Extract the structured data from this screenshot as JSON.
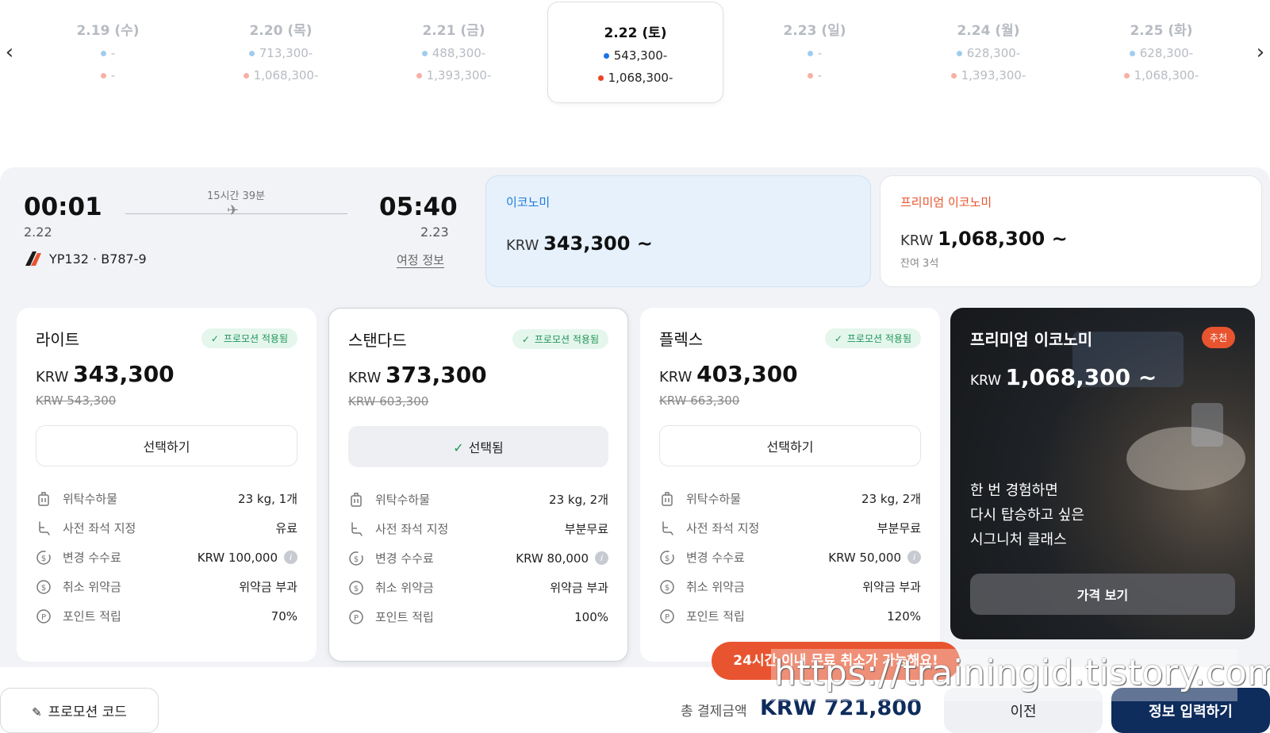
{
  "dates": [
    {
      "label": "2.19 (수)",
      "economy": "-",
      "premium": "-"
    },
    {
      "label": "2.20 (목)",
      "economy": "713,300-",
      "premium": "1,068,300-"
    },
    {
      "label": "2.21 (금)",
      "economy": "488,300-",
      "premium": "1,393,300-"
    },
    {
      "label": "2.22 (토)",
      "economy": "543,300-",
      "premium": "1,068,300-",
      "selected": true
    },
    {
      "label": "2.23 (일)",
      "economy": "-",
      "premium": "-"
    },
    {
      "label": "2.24 (월)",
      "economy": "628,300-",
      "premium": "1,393,300-"
    },
    {
      "label": "2.25 (화)",
      "economy": "628,300-",
      "premium": "1,068,300-"
    }
  ],
  "flight": {
    "dep_time": "00:01",
    "dep_date": "2.22",
    "arr_time": "05:40",
    "arr_date": "2.23",
    "duration": "15시간 39분",
    "flight_no": "YP132 · B787-9",
    "itinerary_link": "여정 정보"
  },
  "cabins": {
    "economy": {
      "name": "이코노미",
      "currency": "KRW",
      "price": "343,300 ~"
    },
    "premium": {
      "name": "프리미엄 이코노미",
      "currency": "KRW",
      "price": "1,068,300 ~",
      "seats_left": "잔여 3석"
    }
  },
  "fares": [
    {
      "name": "라이트",
      "badge": "프로모션 적용됨",
      "currency": "KRW",
      "price": "343,300",
      "original": "KRW 543,300",
      "button": "선택하기",
      "selected": false,
      "features": [
        {
          "label": "위탁수하물",
          "value": "23 kg, 1개"
        },
        {
          "label": "사전 좌석 지정",
          "value": "유료"
        },
        {
          "label": "변경 수수료",
          "value": "KRW 100,000"
        },
        {
          "label": "취소 위약금",
          "value": "위약금 부과"
        },
        {
          "label": "포인트 적립",
          "value": "70%"
        }
      ]
    },
    {
      "name": "스탠다드",
      "badge": "프로모션 적용됨",
      "currency": "KRW",
      "price": "373,300",
      "original": "KRW 603,300",
      "button": "선택됨",
      "selected": true,
      "features": [
        {
          "label": "위탁수하물",
          "value": "23 kg, 2개"
        },
        {
          "label": "사전 좌석 지정",
          "value": "부분무료"
        },
        {
          "label": "변경 수수료",
          "value": "KRW 80,000"
        },
        {
          "label": "취소 위약금",
          "value": "위약금 부과"
        },
        {
          "label": "포인트 적립",
          "value": "100%"
        }
      ]
    },
    {
      "name": "플렉스",
      "badge": "프로모션 적용됨",
      "currency": "KRW",
      "price": "403,300",
      "original": "KRW 663,300",
      "button": "선택하기",
      "selected": false,
      "features": [
        {
          "label": "위탁수하물",
          "value": "23 kg, 2개"
        },
        {
          "label": "사전 좌석 지정",
          "value": "부분무료"
        },
        {
          "label": "변경 수수료",
          "value": "KRW 50,000"
        },
        {
          "label": "취소 위약금",
          "value": "위약금 부과"
        },
        {
          "label": "포인트 적립",
          "value": "120%"
        }
      ]
    }
  ],
  "premium_card": {
    "name": "프리미엄 이코노미",
    "badge": "추천",
    "currency": "KRW",
    "price": "1,068,300 ~",
    "line1": "한 번 경험하면",
    "line2": "다시 탑승하고 싶은",
    "line3": "시그니처 클래스",
    "button": "가격 보기"
  },
  "bottom": {
    "promo_code": "프로모션 코드",
    "cancel_toast": "24시간 이내 무료 취소가 가능해요!",
    "total_label": "총 결제금액",
    "total_value": "KRW 721,800",
    "prev": "이전",
    "next": "정보 입력하기"
  },
  "watermark": "https://trainingid.tistory.com",
  "colors": {
    "accent_navy": "#0e2c5c",
    "accent_orange": "#e8542f",
    "economy_blue": "#1f7ad8",
    "promo_green": "#1f9556"
  }
}
